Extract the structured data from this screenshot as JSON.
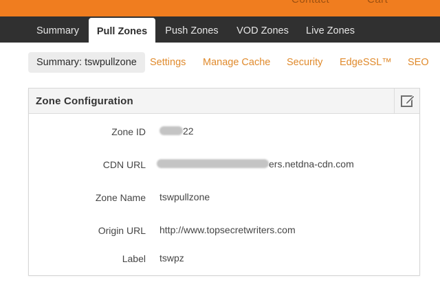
{
  "top_bar": {
    "ghost_left": "Contact",
    "ghost_right": "Cart"
  },
  "main_nav": {
    "tabs": [
      {
        "label": "Summary",
        "active": false
      },
      {
        "label": "Pull Zones",
        "active": true
      },
      {
        "label": "Push Zones",
        "active": false
      },
      {
        "label": "VOD Zones",
        "active": false
      },
      {
        "label": "Live Zones",
        "active": false
      }
    ]
  },
  "sub_nav": {
    "tabs": [
      {
        "label": "Summary: tswpullzone",
        "active": true
      },
      {
        "label": "Settings",
        "active": false
      },
      {
        "label": "Manage Cache",
        "active": false
      },
      {
        "label": "Security",
        "active": false
      },
      {
        "label": "EdgeSSL™",
        "active": false
      },
      {
        "label": "SEO",
        "active": false
      }
    ]
  },
  "panel": {
    "title": "Zone Configuration",
    "edit_icon": "edit-icon",
    "rows": [
      {
        "label": "Zone ID",
        "value": "22"
      },
      {
        "label": "CDN URL",
        "value": "ers.netdna-cdn.com"
      },
      {
        "label": "Zone Name",
        "value": "tswpullzone"
      },
      {
        "label": "Origin URL",
        "value": "http://www.topsecretwriters.com"
      },
      {
        "label": "Label",
        "value": "tswpz"
      }
    ]
  },
  "colors": {
    "brand_orange": "#f07d1f",
    "nav_dark": "#303030",
    "link_orange": "#e08a2c"
  }
}
